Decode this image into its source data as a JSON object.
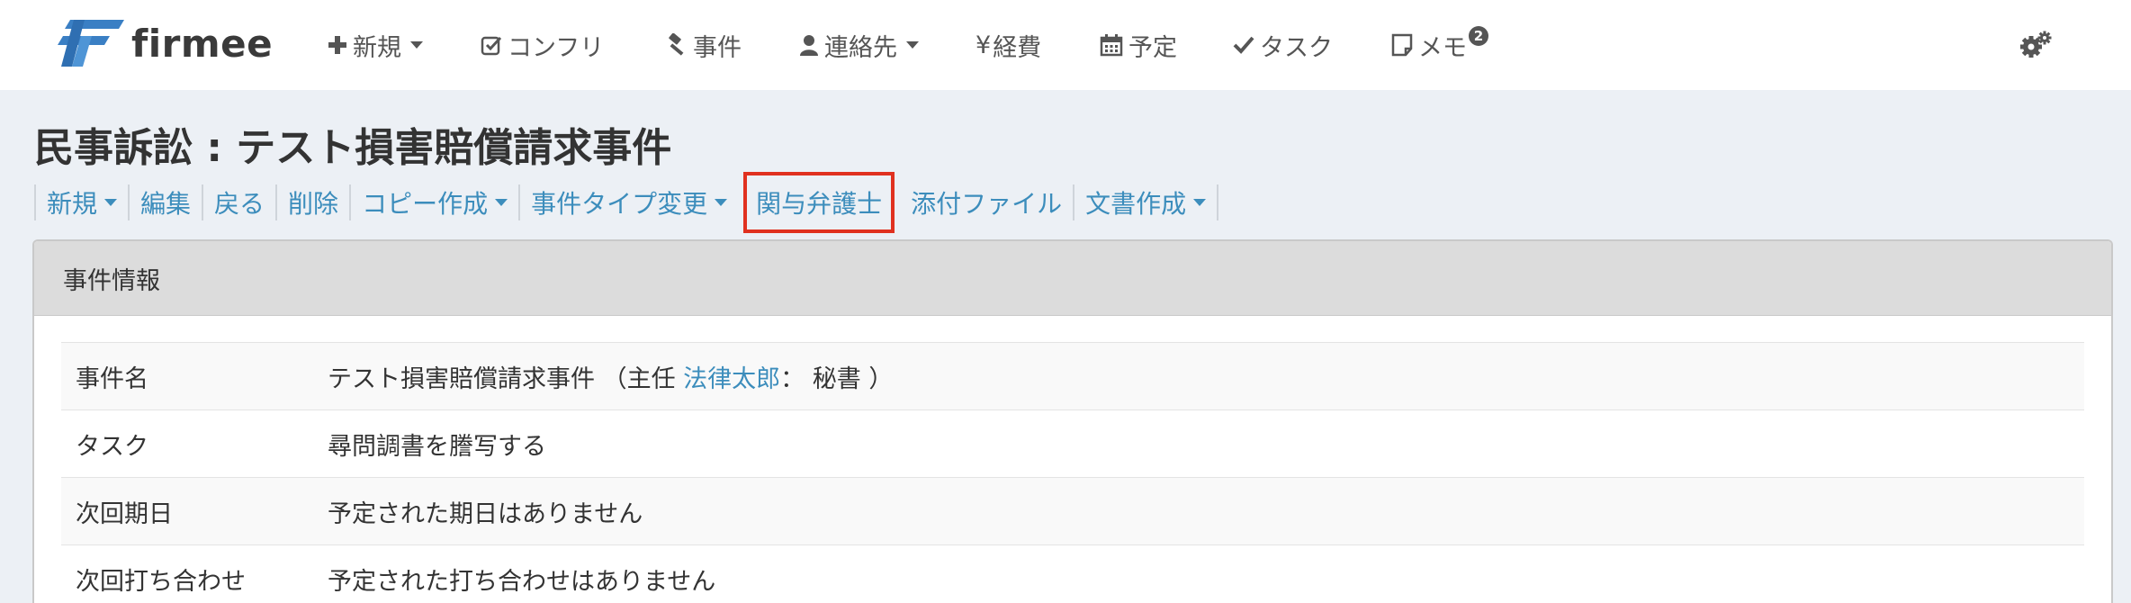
{
  "brand": {
    "name": "firmee"
  },
  "nav": [
    {
      "label": "新規",
      "icon": "plus-icon",
      "dropdown": true
    },
    {
      "label": "コンフリ",
      "icon": "check-square-icon"
    },
    {
      "label": "事件",
      "icon": "gavel-icon"
    },
    {
      "label": "連絡先",
      "icon": "user-icon",
      "dropdown": true
    },
    {
      "label": "経費",
      "icon": "yen-icon",
      "icon_glyph": "¥"
    },
    {
      "label": "予定",
      "icon": "calendar-icon"
    },
    {
      "label": "タスク",
      "icon": "check-icon"
    },
    {
      "label": "メモ",
      "icon": "note-icon",
      "badge": "2"
    }
  ],
  "settings_icon": "gears-icon",
  "page": {
    "title": "民事訴訟 : テスト損害賠償請求事件"
  },
  "actions": [
    {
      "label": "新規",
      "dropdown": true
    },
    {
      "label": "編集"
    },
    {
      "label": "戻る"
    },
    {
      "label": "削除"
    },
    {
      "label": "コピー作成",
      "dropdown": true
    },
    {
      "label": "事件タイプ変更",
      "dropdown": true
    },
    {
      "label": "関与弁護士",
      "highlighted": true
    },
    {
      "label": "添付ファイル"
    },
    {
      "label": "文書作成",
      "dropdown": true
    }
  ],
  "info_box": {
    "header": "事件情報",
    "rows": [
      {
        "label": "事件名",
        "value_prefix": "テスト損害賠償請求事件 （主任 ",
        "value_link": "法律太郎",
        "value_suffix": "： 秘書 ）"
      },
      {
        "label": "タスク",
        "value_link": "尋問調書を謄写する"
      },
      {
        "label": "次回期日",
        "value_link": "予定された期日はありません"
      },
      {
        "label": "次回打ち合わせ",
        "value_link": "予定された打ち合わせはありません"
      }
    ]
  },
  "colors": {
    "link": "#3c8dbc",
    "highlight_border": "#e0311f",
    "logo_blue": "#3a7fc4"
  }
}
